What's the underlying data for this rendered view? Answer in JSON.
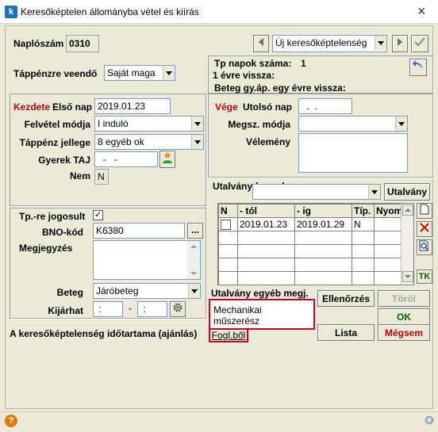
{
  "window": {
    "title": "Keresőképtelen állományba vétel és kiírás",
    "app_icon_letter": "k"
  },
  "header": {
    "naploszam_label": "Naplószám",
    "naploszam_value": "0310",
    "type_value": "Új keresőképtelenség",
    "tappenz_label": "Táppénzre veendő",
    "tappenz_value": "Saját maga"
  },
  "info": {
    "tp_napok_label": "Tp napok száma:",
    "tp_napok_value": "1",
    "egy_eve_label": "1 évre vissza:",
    "beteg_gyap_label": "Beteg gy.áp. egy évre vissza:"
  },
  "kezdete": {
    "title": "Kezdete",
    "elso_nap_label": "Első nap",
    "elso_nap_value": "2019.01.23",
    "felvetel_label": "Felvétel módja",
    "felvetel_value": "I  induló",
    "jelleg_label": "Táppénz jellege",
    "jelleg_value": "8 egyéb ok",
    "gyerek_taj_label": "Gyerek TAJ",
    "gyerek_taj_value": "  -   -",
    "nem_label": "Nem",
    "nem_value": "N"
  },
  "vege": {
    "title": "Vége",
    "utolso_nap_label": "Utolsó nap",
    "utolso_nap_value": "  .  .",
    "megsz_label": "Megsz. módja",
    "velemeny_label": "Vélemény"
  },
  "utalvany": {
    "formula_label": "Utalvány formula",
    "button_label": "Utalvány",
    "columns": [
      "N",
      "- tól",
      "- ig",
      "Típ.",
      "Nyomt"
    ],
    "rows": [
      {
        "n": "",
        "tol": "2019.01.23",
        "ig": "2019.01.29",
        "tip": "N",
        "nyomt": ""
      }
    ],
    "tk_label": "TK"
  },
  "lower": {
    "jogosult_label": "Tp.-re jogosult",
    "jogosult_checked": "✓",
    "bno_label": "BNO-kód",
    "bno_value": "K6380",
    "megjegyzes_label": "Megjegyzés",
    "beteg_label": "Beteg",
    "beteg_value": "Járóbeteg",
    "kijarhat_label": "Kijárhat",
    "kijarhat_from": " :  ",
    "kijarhat_to": " :  ",
    "time_sep": "-"
  },
  "egyeb": {
    "label": "Utalvány egyéb megj.",
    "text": "Mechanikai\nműszerész",
    "fogl_label": "Fogl.ből"
  },
  "duration_label": "A keresőképtelenség időtartama (ajánlás)",
  "buttons": {
    "ellenorzes": "Ellenőrzés",
    "torol": "Töröl",
    "ok": "OK",
    "lista": "Lista",
    "megsem": "Mégsem"
  },
  "icons": {
    "close": "×",
    "dots": "...",
    "question": "?"
  }
}
